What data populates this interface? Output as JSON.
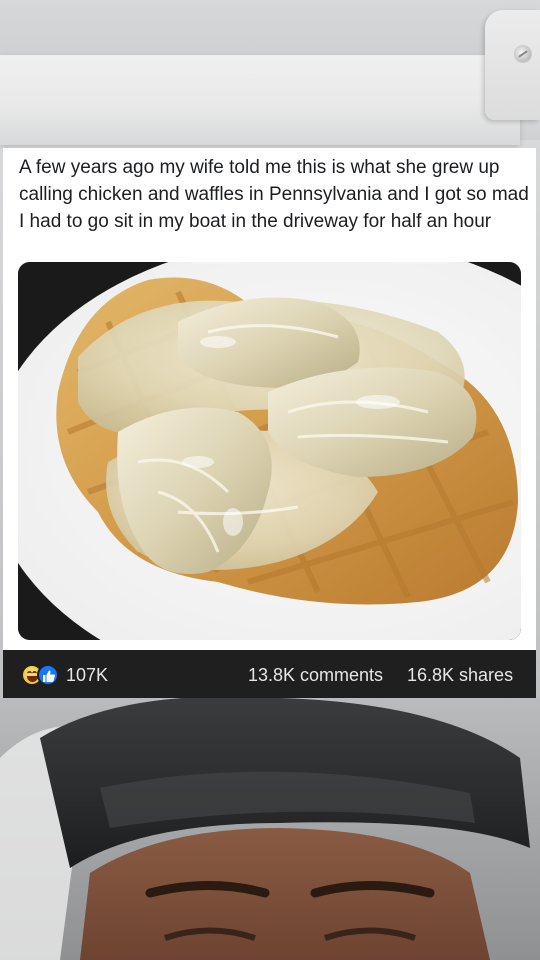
{
  "post": {
    "caption": "A few years ago my wife told me this is what she grew up calling chicken and waffles in Pennsylvania and I got so mad I had to go sit in my boat in the driveway for half an hour"
  },
  "stats": {
    "reaction_icons": [
      "haha-icon",
      "like-icon"
    ],
    "likes": "107K",
    "comments": "13.8K comments",
    "shares": "16.8K shares"
  },
  "colors": {
    "stats_bar_bg": "#1f1f1f",
    "like_blue": "#1877f2",
    "haha_yellow": "#f7c43a",
    "text_dark": "#1c1e21",
    "text_light": "#e6e6e6"
  }
}
